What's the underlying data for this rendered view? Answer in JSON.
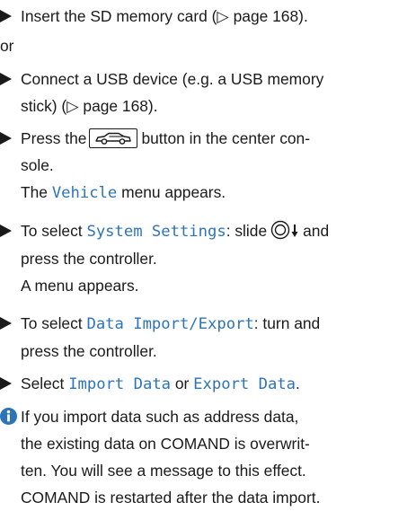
{
  "steps": {
    "insert_sd": "Insert the SD memory card (▷ page 168).",
    "or": "or",
    "connect_usb_line1": "Connect a USB device (e.g. a USB memory",
    "connect_usb_line2": "stick) (▷ page 168).",
    "press_button_pre": "Press the",
    "press_button_post": "button in the center con-",
    "press_button_line2": "sole.",
    "vehicle_pre": "The",
    "vehicle_menu": "Vehicle",
    "vehicle_post": "menu appears.",
    "sys_pre": "To select",
    "sys_settings": "System Settings",
    "sys_mid": ": slide",
    "sys_post": "and",
    "sys_line2": "press the controller.",
    "sys_line3": "A menu appears.",
    "data_pre": "To select",
    "data_ie": "Data Import/Export",
    "data_post": ": turn and",
    "data_line2": "press the controller.",
    "select_pre": "Select",
    "import_data": "Import Data",
    "select_or": "or",
    "export_data": "Export Data",
    "select_end": "."
  },
  "info": {
    "icon": "info-icon",
    "line1": "If you import data such as address data,",
    "line2": "the existing data on COMAND is overwrit-",
    "line3": "ten. You will see a message to this effect.",
    "line4": "COMAND is restarted after the data import."
  },
  "icons": {
    "bullet": "triangle-bullet-icon",
    "vehicle_button": "car-button-icon",
    "controller": "controller-slide-down-icon"
  },
  "colors": {
    "menu_text": "#2d74b7",
    "info_icon": "#2d74b7",
    "body_text": "#1a1a1a"
  }
}
